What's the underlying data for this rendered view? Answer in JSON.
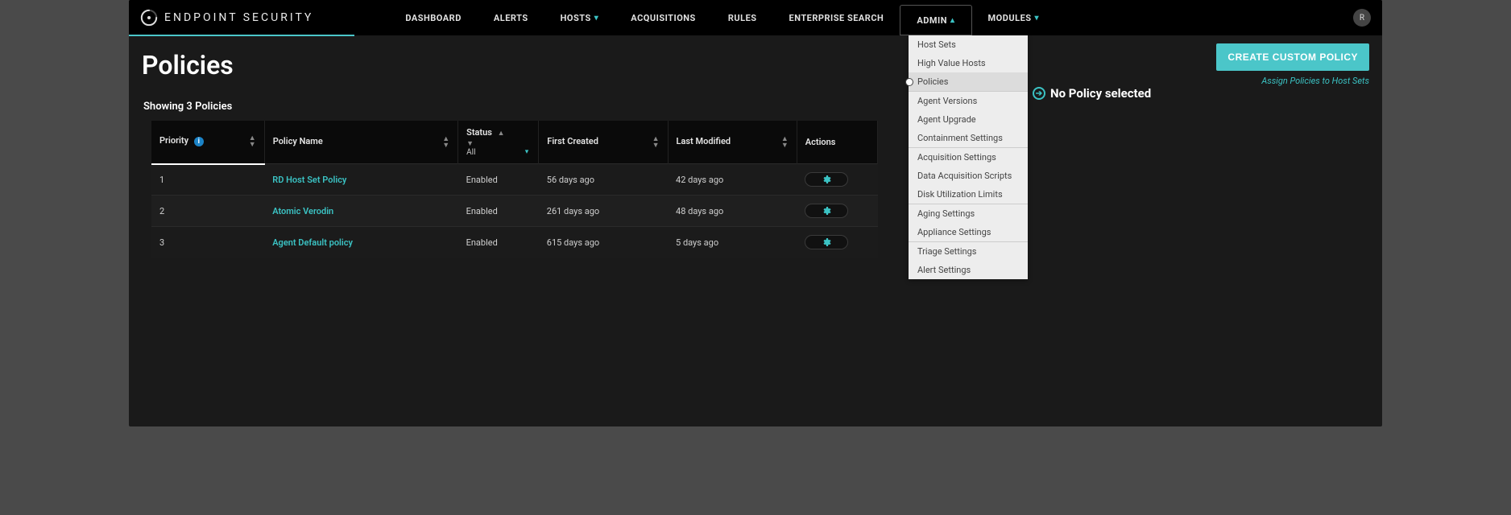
{
  "brand": "ENDPOINT SECURITY",
  "nav": {
    "dashboard": "DASHBOARD",
    "alerts": "ALERTS",
    "hosts": "HOSTS",
    "acquisitions": "ACQUISITIONS",
    "rules": "RULES",
    "enterprise_search": "ENTERPRISE SEARCH",
    "admin": "ADMIN",
    "modules": "MODULES"
  },
  "avatar_initial": "R",
  "admin_menu": {
    "group1": [
      "Host Sets",
      "High Value Hosts",
      "Policies"
    ],
    "group2": [
      "Agent Versions",
      "Agent Upgrade",
      "Containment Settings"
    ],
    "group3": [
      "Acquisition Settings",
      "Data Acquisition Scripts",
      "Disk Utilization Limits"
    ],
    "group4": [
      "Aging Settings",
      "Appliance Settings"
    ],
    "group5": [
      "Triage Settings",
      "Alert Settings"
    ],
    "selected": "Policies"
  },
  "page": {
    "title": "Policies",
    "create_button": "CREATE CUSTOM POLICY",
    "assign_link": "Assign Policies to Host Sets",
    "showing": "Showing 3 Policies",
    "no_selection": "No Policy selected"
  },
  "table": {
    "headers": {
      "priority": "Priority",
      "policy_name": "Policy Name",
      "status": "Status",
      "status_filter": "All",
      "first_created": "First Created",
      "last_modified": "Last Modified",
      "actions": "Actions"
    },
    "rows": [
      {
        "priority": "1",
        "name": "RD Host Set Policy",
        "status": "Enabled",
        "created": "56 days ago",
        "modified": "42 days ago"
      },
      {
        "priority": "2",
        "name": "Atomic Verodin",
        "status": "Enabled",
        "created": "261 days ago",
        "modified": "48 days ago"
      },
      {
        "priority": "3",
        "name": "Agent Default policy",
        "status": "Enabled",
        "created": "615 days ago",
        "modified": "5 days ago"
      }
    ]
  }
}
